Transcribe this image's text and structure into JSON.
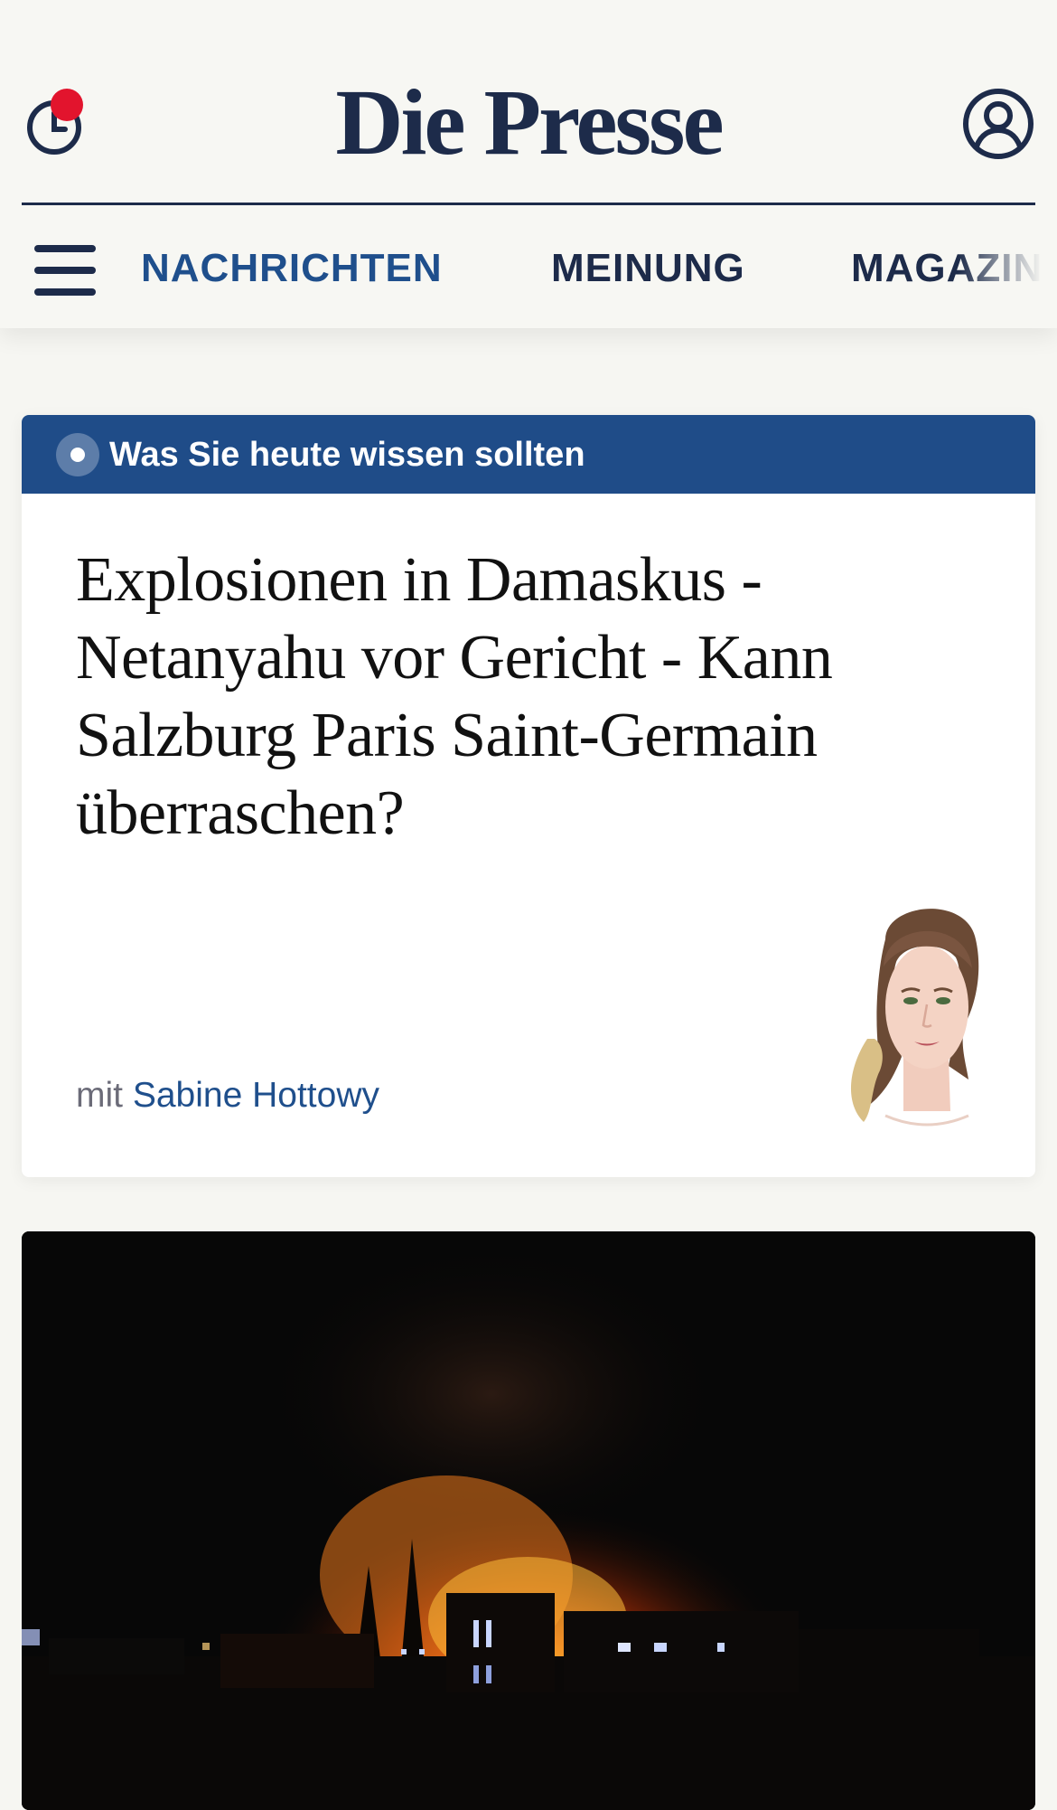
{
  "header": {
    "logo_text": "Die Presse",
    "history_icon": "clock-icon",
    "account_icon": "user-circle-icon",
    "notification_color": "#e2142d"
  },
  "nav": {
    "menu_icon": "hamburger-menu-icon",
    "items": [
      {
        "label": "NACHRICHTEN",
        "active": true
      },
      {
        "label": "MEINUNG",
        "active": false
      },
      {
        "label": "MAGAZIN",
        "active": false
      }
    ]
  },
  "briefing": {
    "banner_label": "Was Sie heute wissen sollten",
    "headline": "Explosionen in Damaskus - Netanyahu vor Gericht - Kann Salzburg Paris Saint-Germain überraschen?",
    "byline_prefix": "mit",
    "author": "Sabine Hottowy"
  },
  "hero_image": {
    "description_icon": "night-fire-photo"
  },
  "colors": {
    "brand_navy": "#1d2b4a",
    "accent_blue": "#1f4f8c",
    "banner_blue": "#1f4c88",
    "background": "#f6f6f2"
  }
}
